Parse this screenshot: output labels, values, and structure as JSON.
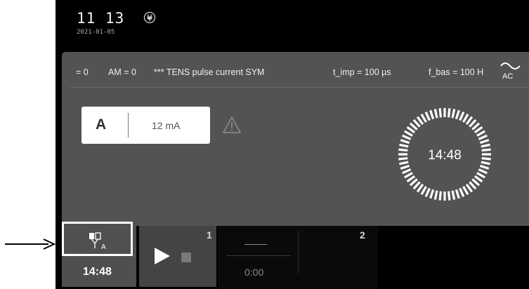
{
  "status_bar": {
    "time": "11 13",
    "date": "2021-01-05",
    "power_icon": "power-plug-icon"
  },
  "params": {
    "p1": "= 0",
    "p2": "AM = 0",
    "p3": "*** TENS pulse current SYM",
    "p4": "t_imp = 100 µs",
    "p5": "f_bas = 100 H",
    "ac_label": "AC"
  },
  "channel": {
    "letter": "A",
    "intensity": "12 mA",
    "warning_icon": "warning-triangle-icon"
  },
  "timer": {
    "remaining": "14:48"
  },
  "footer": {
    "electrode_subscript": "A",
    "electrode_time": "14:48",
    "channel1_number": "1",
    "channel2_number": "2",
    "channel2_time": "0:00"
  },
  "colors": {
    "panel": "#535353",
    "background": "#000000",
    "highlight_frame": "#ffffff"
  }
}
